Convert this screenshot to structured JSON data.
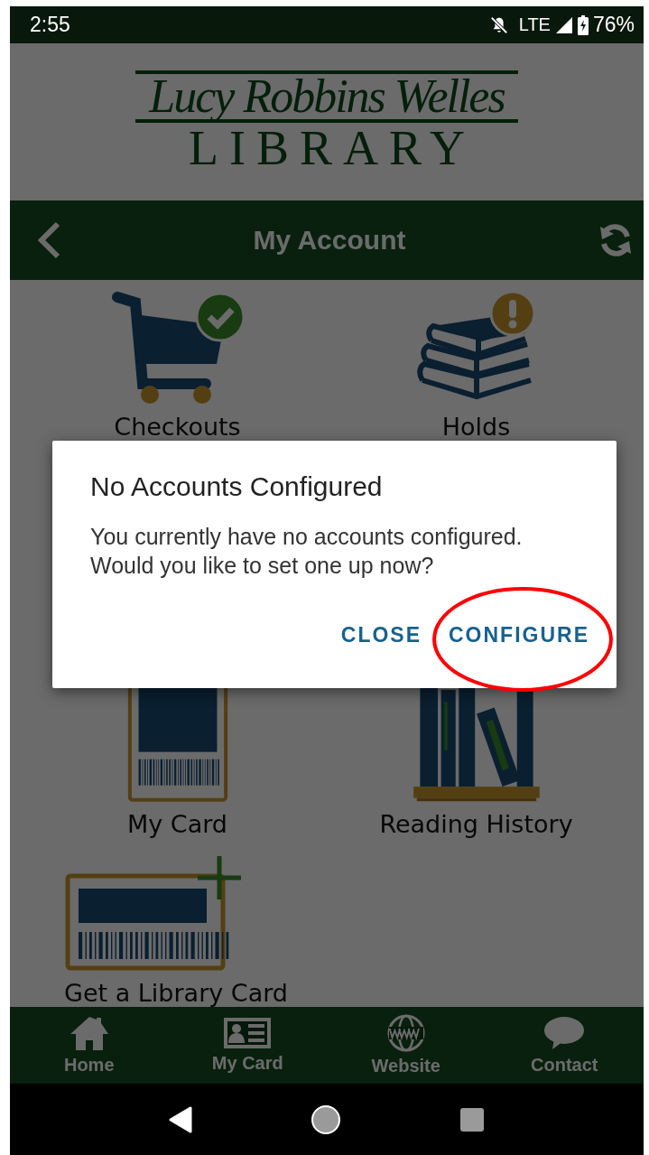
{
  "status_bar": {
    "time": "2:55",
    "network": "LTE",
    "battery": "76%"
  },
  "logo": {
    "line_1": "Lucy Robbins Welles",
    "line_2": "LIBRARY"
  },
  "nav_bar": {
    "title": "My Account"
  },
  "tiles": [
    {
      "label": "Checkouts",
      "kind": "cart"
    },
    {
      "label": "Holds",
      "kind": "books"
    },
    {
      "label": "My Card",
      "kind": "card"
    },
    {
      "label": "Reading History",
      "kind": "shelf"
    },
    {
      "label": "Get a Library Card",
      "kind": "new-card"
    }
  ],
  "dialog": {
    "title": "No Accounts Configured",
    "message": "You currently have no accounts configured.\nWould you like to set one up now?",
    "buttons": [
      {
        "label": "CLOSE",
        "circled": false
      },
      {
        "label": "CONFIGURE",
        "circled": true
      }
    ]
  },
  "tab_bar": [
    {
      "label": "Home",
      "kind": "home"
    },
    {
      "label": "My Card",
      "kind": "card"
    },
    {
      "label": "Website",
      "kind": "web"
    },
    {
      "label": "Contact",
      "kind": "chat"
    }
  ]
}
